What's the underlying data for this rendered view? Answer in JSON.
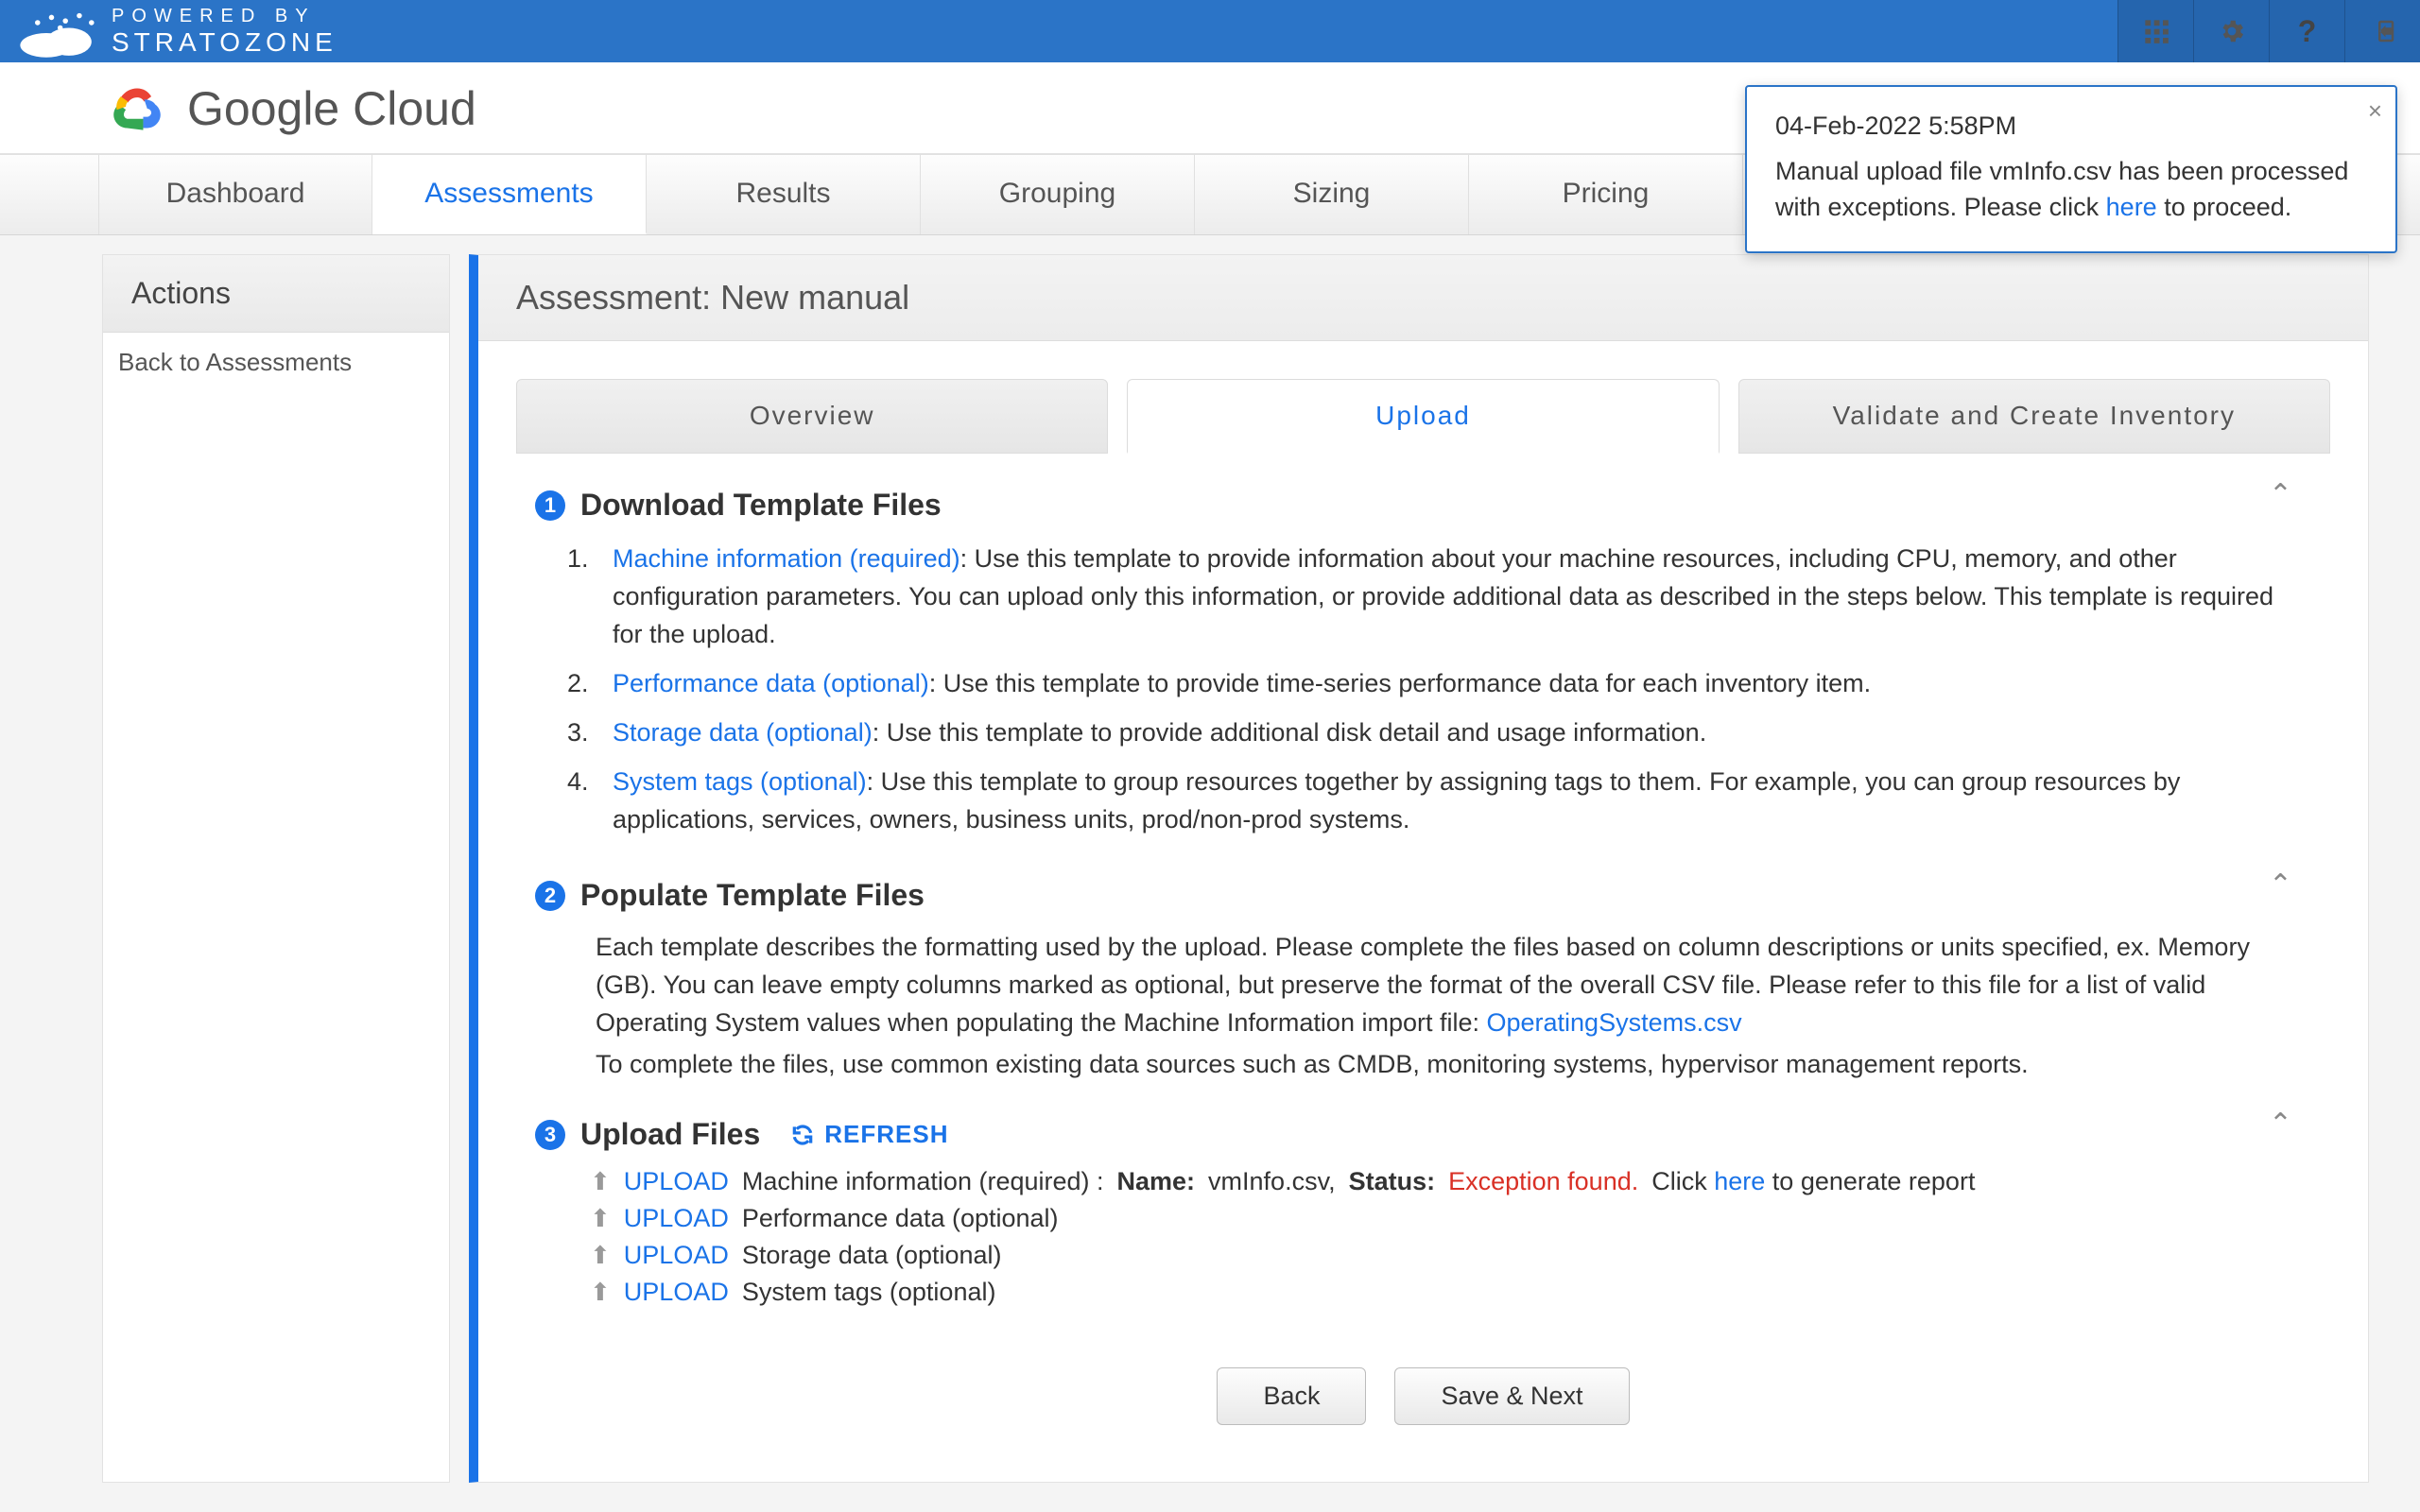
{
  "topbar": {
    "powered": "POWERED BY",
    "brand": "STRATOZONE"
  },
  "brand": {
    "google": "Google",
    "cloud": " Cloud"
  },
  "nav": [
    {
      "label": "Dashboard",
      "active": false
    },
    {
      "label": "Assessments",
      "active": true
    },
    {
      "label": "Results",
      "active": false
    },
    {
      "label": "Grouping",
      "active": false
    },
    {
      "label": "Sizing",
      "active": false
    },
    {
      "label": "Pricing",
      "active": false
    }
  ],
  "sidebar": {
    "title": "Actions",
    "back": "Back to Assessments"
  },
  "content": {
    "title": "Assessment: New manual",
    "subtabs": [
      {
        "label": "Overview",
        "active": false
      },
      {
        "label": "Upload",
        "active": true
      },
      {
        "label": "Validate and Create Inventory",
        "active": false
      }
    ]
  },
  "step1": {
    "num": "1",
    "title": "Download Template Files",
    "items": [
      {
        "link": "Machine information (required)",
        "text": ": Use this template to provide information about your machine resources, including CPU, memory, and other configuration parameters. You can upload only this information, or provide additional data as described in the steps below. This template is required for the upload."
      },
      {
        "link": "Performance data (optional)",
        "text": ": Use this template to provide time-series performance data for each inventory item."
      },
      {
        "link": "Storage data (optional)",
        "text": ": Use this template to provide additional disk detail and usage information."
      },
      {
        "link": "System tags (optional)",
        "text": ": Use this template to group resources together by assigning tags to them. For example, you can group resources by applications, services, owners, business units, prod/non-prod systems."
      }
    ]
  },
  "step2": {
    "num": "2",
    "title": "Populate Template Files",
    "para_a": "Each template describes the formatting used by the upload. Please complete the files based on column descriptions or units specified, ex. Memory (GB). You can leave empty columns marked as optional, but preserve the format of the overall CSV file. Please refer to this file for a list of valid Operating System values when populating the Machine Information import file: ",
    "os_link": "OperatingSystems.csv",
    "para_b": "To complete the files, use common existing data sources such as CMDB, monitoring systems, hypervisor management reports."
  },
  "step3": {
    "num": "3",
    "title": "Upload Files",
    "refresh": "REFRESH",
    "rows": [
      {
        "upload": "UPLOAD",
        "label": "Machine information (required) :",
        "name_label": "Name:",
        "name_val": "vmInfo.csv,",
        "status_label": "Status:",
        "status_val": "Exception found.",
        "click": "Click ",
        "here": "here",
        "tail": " to generate report"
      },
      {
        "upload": "UPLOAD",
        "label": "Performance data (optional)"
      },
      {
        "upload": "UPLOAD",
        "label": "Storage data (optional)"
      },
      {
        "upload": "UPLOAD",
        "label": "System tags (optional)"
      }
    ]
  },
  "buttons": {
    "back": "Back",
    "save": "Save & Next"
  },
  "toast": {
    "time": "04-Feb-2022 5:58PM",
    "msg_a": "Manual upload file vmInfo.csv has been processed with exceptions. Please click ",
    "here": "here",
    "msg_b": " to proceed."
  }
}
